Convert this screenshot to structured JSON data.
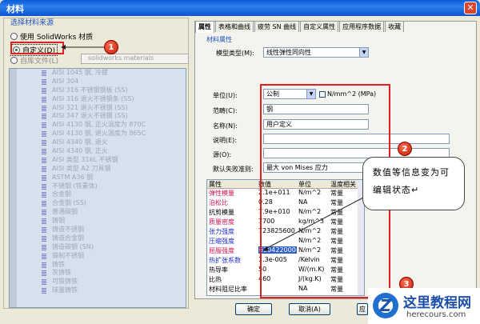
{
  "window": {
    "title": "材料",
    "close_glyph": "✕"
  },
  "source": {
    "group_title": "选择材料来源",
    "opt_solidworks": "使用 SolidWorks 材质",
    "opt_custom": "自定义(D)",
    "opt_library": "自库文件(L)",
    "library_combo": "solidworks materials"
  },
  "tree_items": [
    "AISI 1045 钢, 冷拔",
    "AISI 304",
    "AISI 316 不锈钢钢板 (SS)",
    "AISI 316 退火不锈钢条 (SS)",
    "AISI 321 退火不锈钢 (SS)",
    "AISI 347 退火不锈钢 (SS)",
    "AISI 4130 钢, 正火温度为 870C",
    "AISI 4130 钢, 退火温度为 865C",
    "AISI 4340 钢, 退火",
    "AISI 4340 钢, 正火",
    "AISI 类型 316L 不锈钢",
    "AISI 类型 A2 刀具钢",
    "ASTM A36 钢",
    "不锈钢 (铁素体)",
    "合金钢",
    "合金钢 (SS)",
    "普通碳钢",
    "铸钢",
    "铸造不锈钢",
    "铸造合金钢",
    "铸造碳钢 (SN)",
    "锻制不锈钢",
    "铸铁",
    "灰铸铁",
    "可锻铸铁",
    "球墨铸铁"
  ],
  "tabs": [
    "属性",
    "表格和曲线",
    "疲劳 SN 曲线",
    "自定义属性",
    "应用程序数据",
    "收藏"
  ],
  "props": {
    "group_title": "材料属性",
    "model_type_label": "模型类型(M):",
    "model_type_value": "线性弹性同向性",
    "unit_label": "单位(U):",
    "unit_value": "公制",
    "unit_checkbox": "N/mm^2 (MPa)",
    "category_label": "范畴(C):",
    "category_value": "钢",
    "name_label": "名称(N):",
    "name_value": "用户定义",
    "desc_label": "说明(E):",
    "desc_value": "",
    "source_label": "源(O):",
    "source_value": "",
    "failure_label": "默认失败准则:",
    "failure_value": "最大 von Mises 应力"
  },
  "table": {
    "headers": [
      "属性",
      "数值",
      "单位",
      "温度相关"
    ],
    "rows": [
      {
        "name": "弹性模量",
        "value": "2.1e+011",
        "unit": "N/m^2",
        "temp": "常量",
        "color": "red"
      },
      {
        "name": "泊松比",
        "value": "0.28",
        "unit": "NA",
        "temp": "常量",
        "color": "red"
      },
      {
        "name": "抗剪模量",
        "value": "7.9e+010",
        "unit": "N/m^2",
        "temp": "常量",
        "color": "black"
      },
      {
        "name": "质量密度",
        "value": "7700",
        "unit": "kg/m^3",
        "temp": "常量",
        "color": "red"
      },
      {
        "name": "张力强度",
        "value": "723825600",
        "unit": "N/m^2",
        "temp": "常量",
        "color": "blue"
      },
      {
        "name": "压缩强度",
        "value": "",
        "unit": "N/m^2",
        "temp": "常量",
        "color": "blue"
      },
      {
        "name": "屈服强度",
        "value": "620422000",
        "unit": "N/m^2",
        "temp": "常量",
        "color": "red"
      },
      {
        "name": "热扩张系数",
        "value": "1.3e-005",
        "unit": "/Kelvin",
        "temp": "常量",
        "color": "blue"
      },
      {
        "name": "热导率",
        "value": "50",
        "unit": "W/(m.K)",
        "temp": "常量",
        "color": "black"
      },
      {
        "name": "比热",
        "value": "460",
        "unit": "J/(kg.K)",
        "temp": "常量",
        "color": "black"
      },
      {
        "name": "材料阻尼比率",
        "value": "",
        "unit": "NA",
        "temp": "常量",
        "color": "black"
      }
    ]
  },
  "callout": "数值等信息变为可编辑状态↵",
  "badges": [
    "1",
    "2",
    "3"
  ],
  "buttons": {
    "ok": "确定",
    "cancel": "取消(A)",
    "apply": "应"
  },
  "watermark": {
    "logo": "Z",
    "name": "这里教程网",
    "url": "herecours.com"
  }
}
